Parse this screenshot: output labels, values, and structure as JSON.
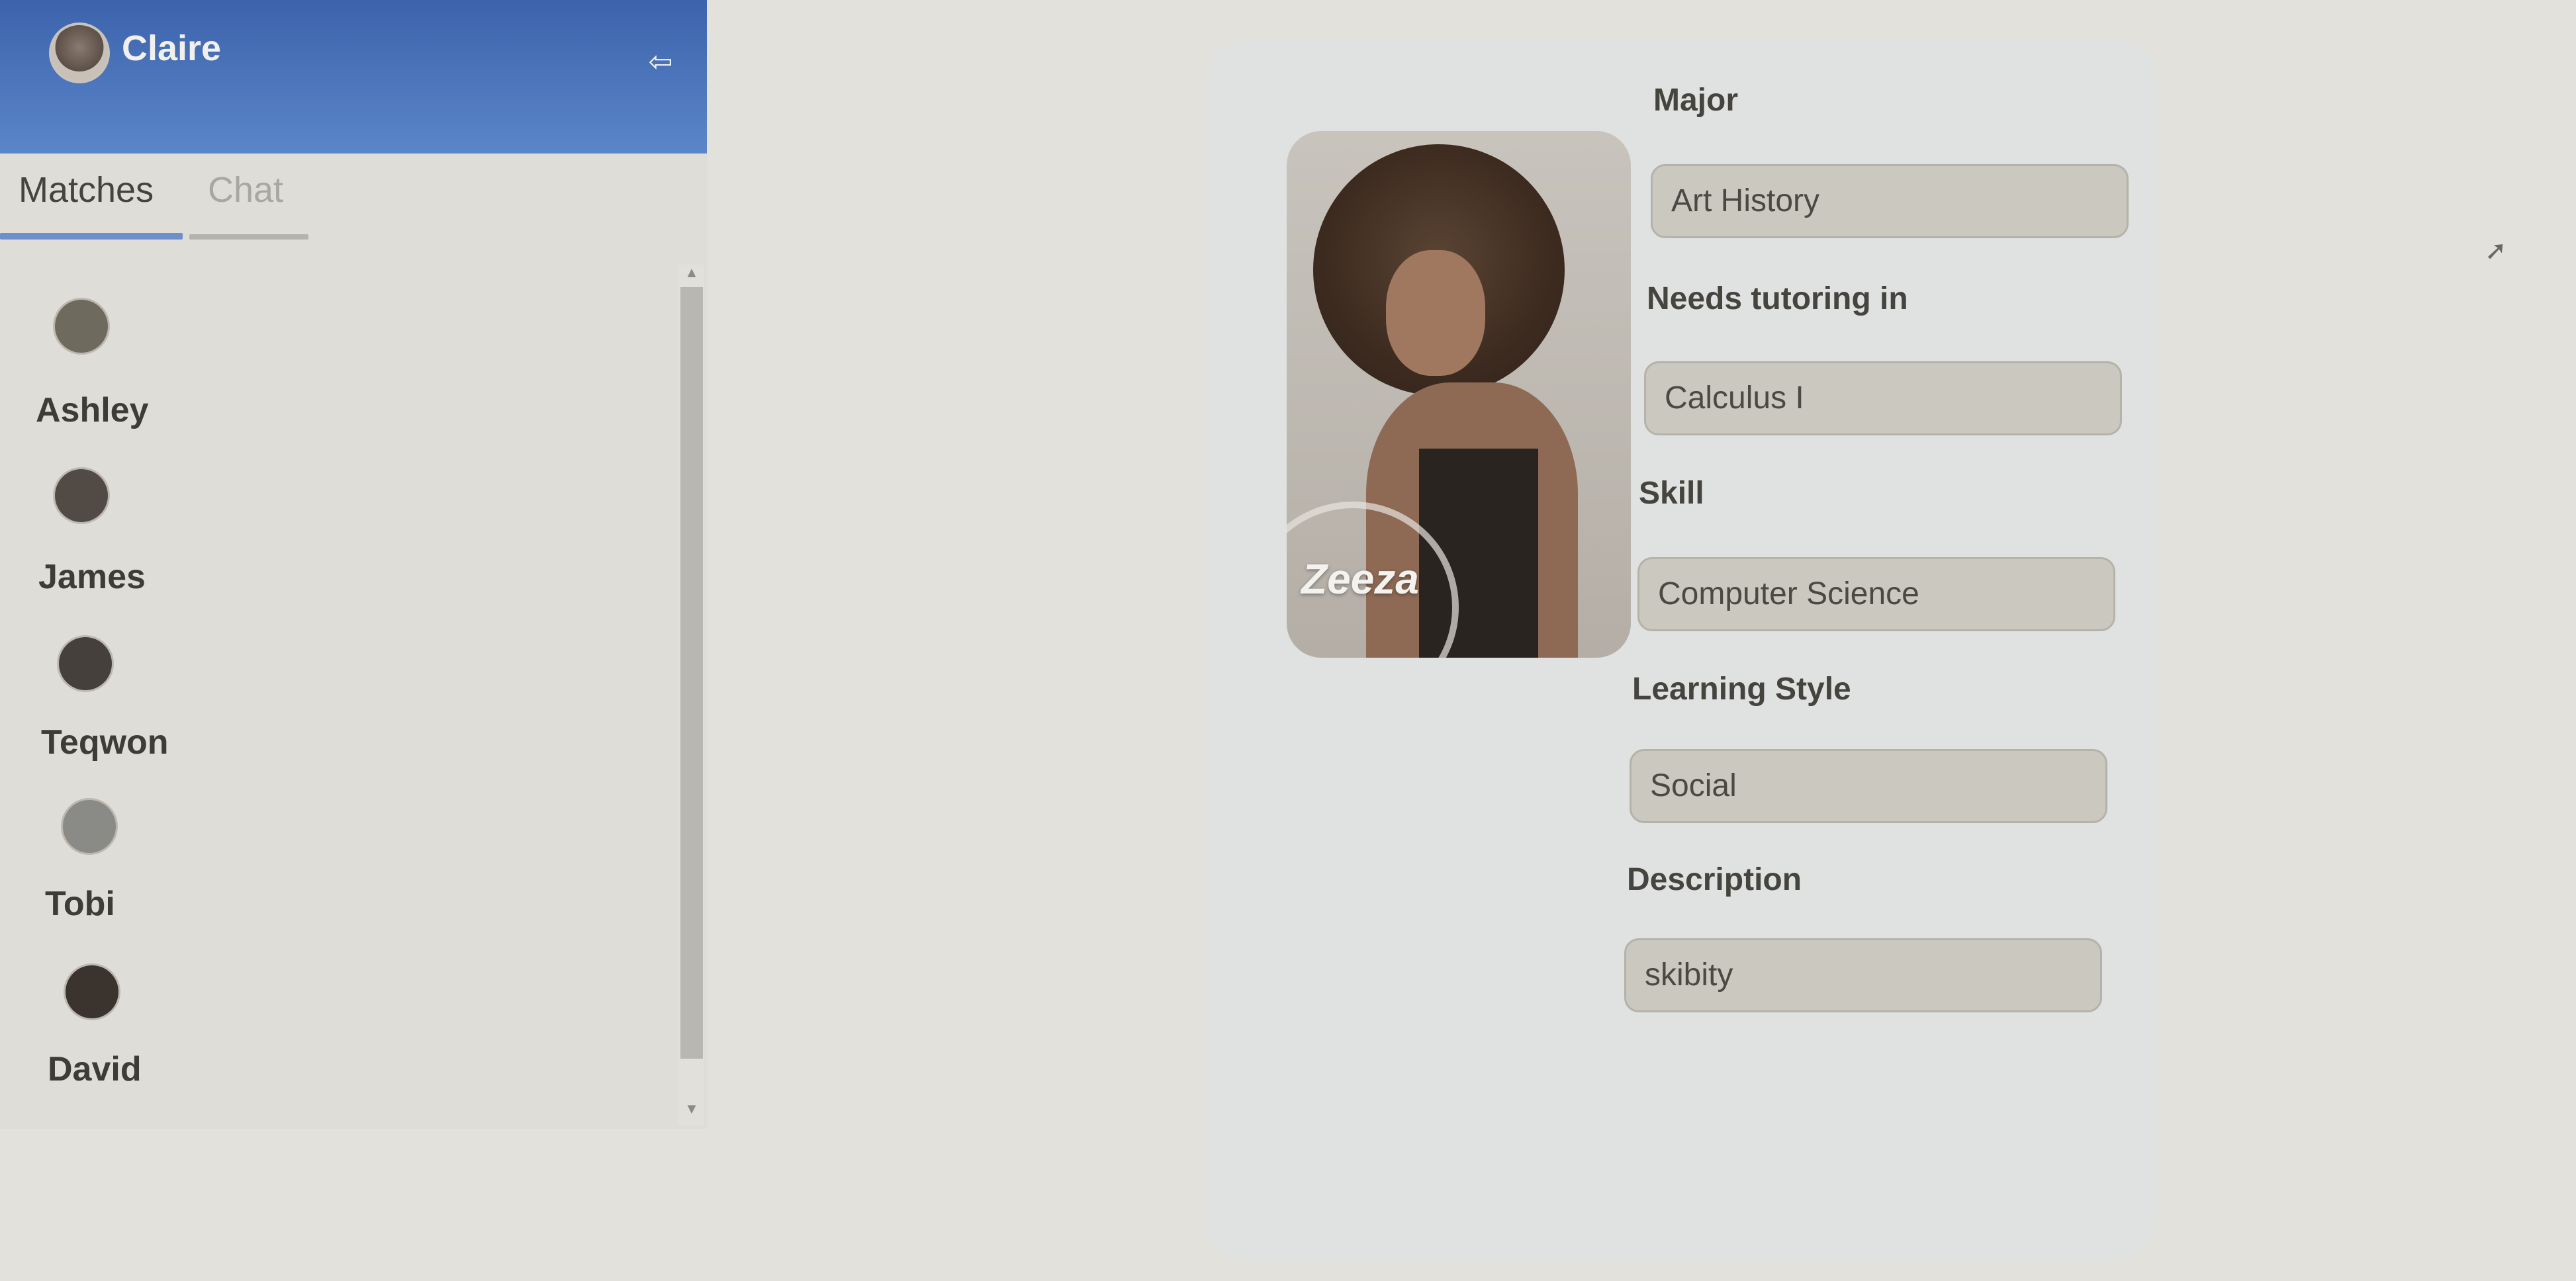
{
  "sidebar": {
    "user_name": "Claire",
    "tabs": [
      {
        "label": "Matches"
      },
      {
        "label": "Chat"
      }
    ],
    "matches": [
      {
        "name": "Ashley"
      },
      {
        "name": "James"
      },
      {
        "name": "Teqwon"
      },
      {
        "name": "Tobi"
      },
      {
        "name": "David"
      }
    ]
  },
  "profile": {
    "photo_name": "Zeeza",
    "fields": [
      {
        "label": "Major",
        "value": "Art History"
      },
      {
        "label": "Needs tutoring in",
        "value": "Calculus I"
      },
      {
        "label": "Skill",
        "value": "Computer Science"
      },
      {
        "label": "Learning Style",
        "value": "Social"
      },
      {
        "label": "Description",
        "value": "skibity"
      }
    ]
  },
  "colors": {
    "header_blue": "#3c63ac",
    "active_tab_underline": "#6e8fcc"
  }
}
